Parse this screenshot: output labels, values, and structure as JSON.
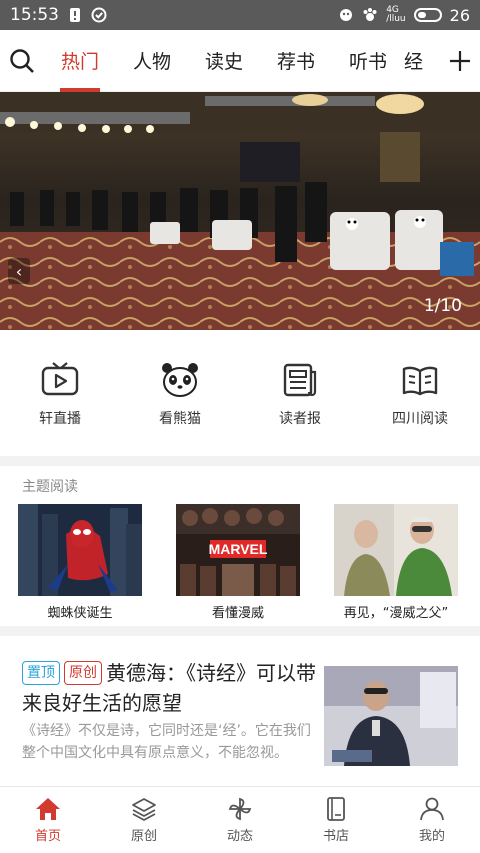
{
  "status_bar": {
    "time": "15:53",
    "network_label": "4G",
    "signal_text": "/lluu",
    "battery": "26"
  },
  "top_nav": {
    "tabs": [
      {
        "label": "热门",
        "active": true
      },
      {
        "label": "人物"
      },
      {
        "label": "读史"
      },
      {
        "label": "荐书"
      },
      {
        "label": "听书"
      },
      {
        "label": "经"
      }
    ]
  },
  "banner": {
    "counter": "1/10",
    "prev_glyph": "‹"
  },
  "quick_links": [
    {
      "label": "轩直播",
      "icon": "tv-play-icon"
    },
    {
      "label": "看熊猫",
      "icon": "panda-icon"
    },
    {
      "label": "读者报",
      "icon": "newspaper-icon"
    },
    {
      "label": "四川阅读",
      "icon": "open-book-icon"
    }
  ],
  "topic_reading": {
    "heading": "主题阅读",
    "cards": [
      {
        "caption": "蜘蛛侠诞生"
      },
      {
        "caption": "看懂漫威",
        "logo_text": "MARVEL"
      },
      {
        "caption": "再见，“漫威之父”"
      }
    ]
  },
  "article": {
    "tag_top": "置顶",
    "tag_original": "原创",
    "title": "黄德海：《诗经》可以带来良好生活的愿望",
    "summary": "《诗经》不仅是诗，它同时还是‘经’。它在我们整个中国文化中具有原点意义，不能忽视。"
  },
  "bottom_nav": [
    {
      "label": "首页",
      "icon": "home-icon",
      "active": true
    },
    {
      "label": "原创",
      "icon": "layers-icon"
    },
    {
      "label": "动态",
      "icon": "pinwheel-icon"
    },
    {
      "label": "书店",
      "icon": "book-icon"
    },
    {
      "label": "我的",
      "icon": "user-icon"
    }
  ],
  "colors": {
    "accent": "#d03a2f",
    "tag_blue": "#2aa4d8",
    "status_bar": "#5a5a5a"
  }
}
